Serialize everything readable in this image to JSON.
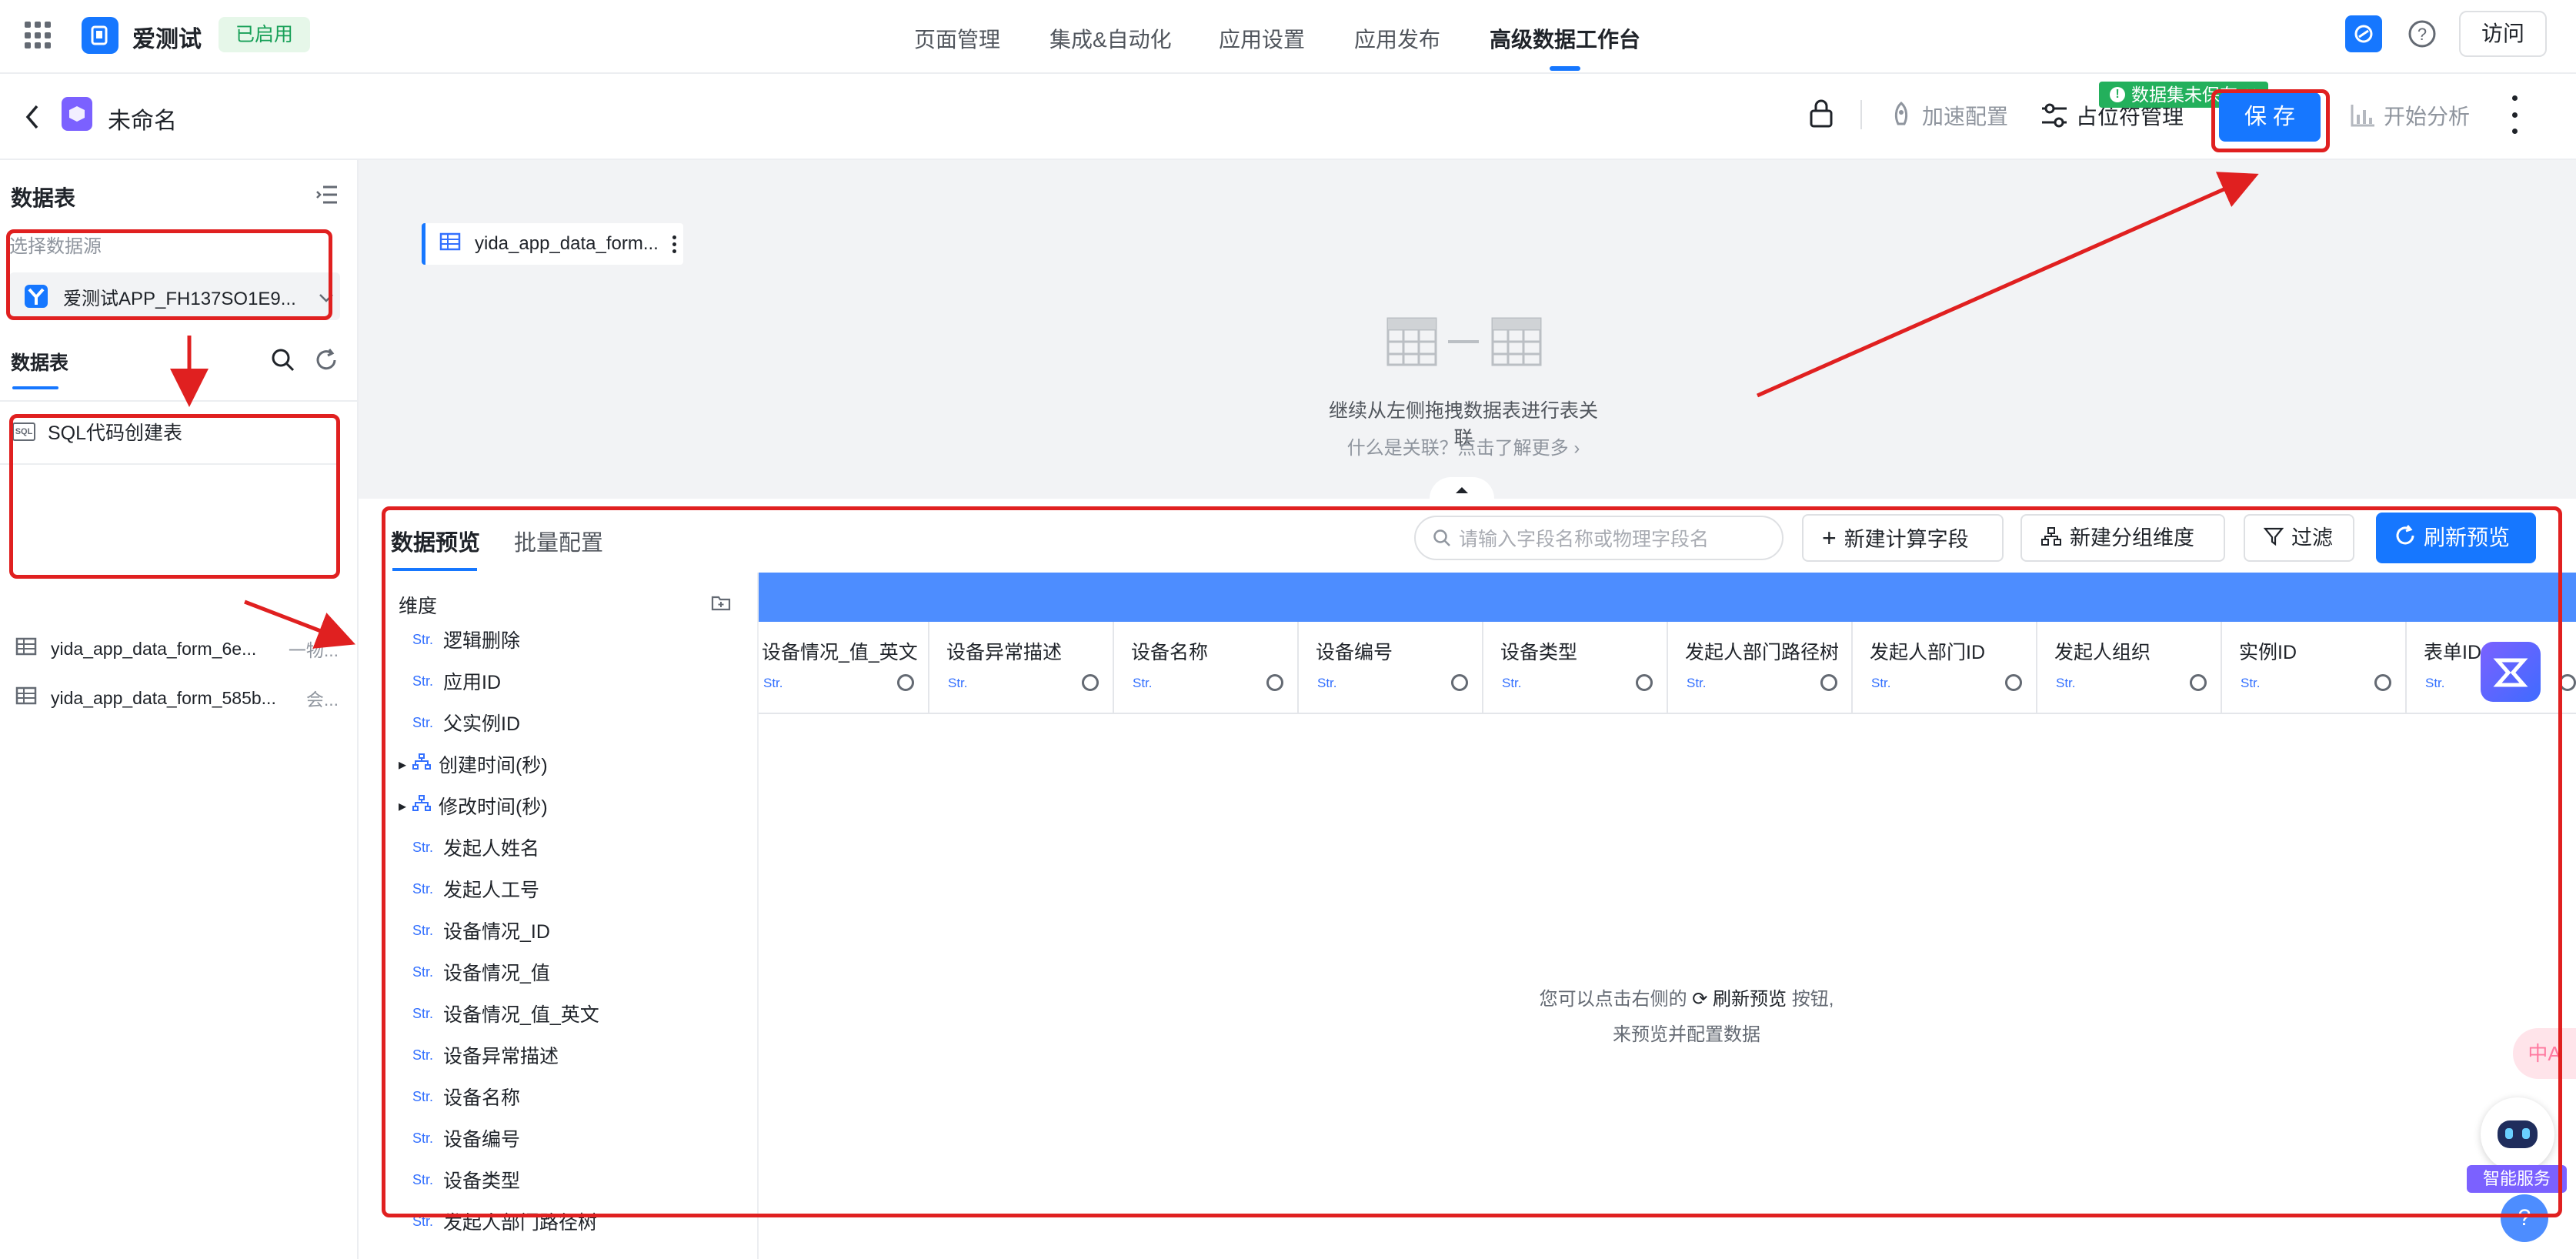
{
  "header": {
    "app_name": "爱测试",
    "status_badge": "已启用",
    "nav": [
      "页面管理",
      "集成&自动化",
      "应用设置",
      "应用发布",
      "高级数据工作台"
    ],
    "visit_label": "访问"
  },
  "subbar": {
    "title": "未命名",
    "accelerate_label": "加速配置",
    "placeholder_label": "占位符管理",
    "save_label": "保 存",
    "unsaved_tip": "数据集未保存",
    "analyze_label": "开始分析"
  },
  "sidebar": {
    "title": "数据表",
    "datasource_label": "选择数据源",
    "datasource_value": "爱测试APP_FH137SO1E9...",
    "tables_tab": "数据表",
    "tables": [
      {
        "name": "SQL代码创建表",
        "extra": ""
      },
      {
        "name": "yida_app_data_form_6e...",
        "extra": "一物..."
      },
      {
        "name": "yida_app_data_form_585b...",
        "extra": "会..."
      }
    ]
  },
  "canvas": {
    "node_label": "yida_app_data_form...",
    "hint": "继续从左侧拖拽数据表进行表关联",
    "link": "什么是关联？点击了解更多 ›"
  },
  "preview": {
    "tabs": [
      "数据预览",
      "批量配置"
    ],
    "search_placeholder": "请输入字段名称或物理字段名",
    "new_calc_field": "新建计算字段",
    "new_group_dim": "新建分组维度",
    "filter": "过滤",
    "refresh": "刷新预览",
    "dimension_title": "维度",
    "fields": [
      {
        "type": "Str.",
        "name": "逻辑删除",
        "expandable": false
      },
      {
        "type": "Str.",
        "name": "应用ID",
        "expandable": false
      },
      {
        "type": "Str.",
        "name": "父实例ID",
        "expandable": false
      },
      {
        "type": "tree",
        "name": "创建时间(秒)",
        "expandable": true
      },
      {
        "type": "tree",
        "name": "修改时间(秒)",
        "expandable": true
      },
      {
        "type": "Str.",
        "name": "发起人姓名",
        "expandable": false
      },
      {
        "type": "Str.",
        "name": "发起人工号",
        "expandable": false
      },
      {
        "type": "Str.",
        "name": "设备情况_ID",
        "expandable": false
      },
      {
        "type": "Str.",
        "name": "设备情况_值",
        "expandable": false
      },
      {
        "type": "Str.",
        "name": "设备情况_值_英文",
        "expandable": false
      },
      {
        "type": "Str.",
        "name": "设备异常描述",
        "expandable": false
      },
      {
        "type": "Str.",
        "name": "设备名称",
        "expandable": false
      },
      {
        "type": "Str.",
        "name": "设备编号",
        "expandable": false
      },
      {
        "type": "Str.",
        "name": "设备类型",
        "expandable": false
      },
      {
        "type": "Str.",
        "name": "发起人部门路径树",
        "expandable": false
      }
    ],
    "columns": [
      {
        "title": "设备情况_值_英文",
        "type": "Str."
      },
      {
        "title": "设备异常描述",
        "type": "Str."
      },
      {
        "title": "设备名称",
        "type": "Str."
      },
      {
        "title": "设备编号",
        "type": "Str."
      },
      {
        "title": "设备类型",
        "type": "Str."
      },
      {
        "title": "发起人部门路径树",
        "type": "Str."
      },
      {
        "title": "发起人部门ID",
        "type": "Str."
      },
      {
        "title": "发起人组织",
        "type": "Str."
      },
      {
        "title": "实例ID",
        "type": "Str."
      },
      {
        "title": "表单ID",
        "type": "Str."
      }
    ],
    "empty_line1_a": "您可以点击右侧的",
    "empty_line1_b": "刷新预览",
    "empty_line1_c": "按钮,",
    "empty_line2": "来预览并配置数据"
  },
  "widgets": {
    "assistant_label": "智能服务"
  },
  "colors": {
    "primary": "#1677ff",
    "annotation_red": "#e02020",
    "success_green": "#18a058"
  }
}
